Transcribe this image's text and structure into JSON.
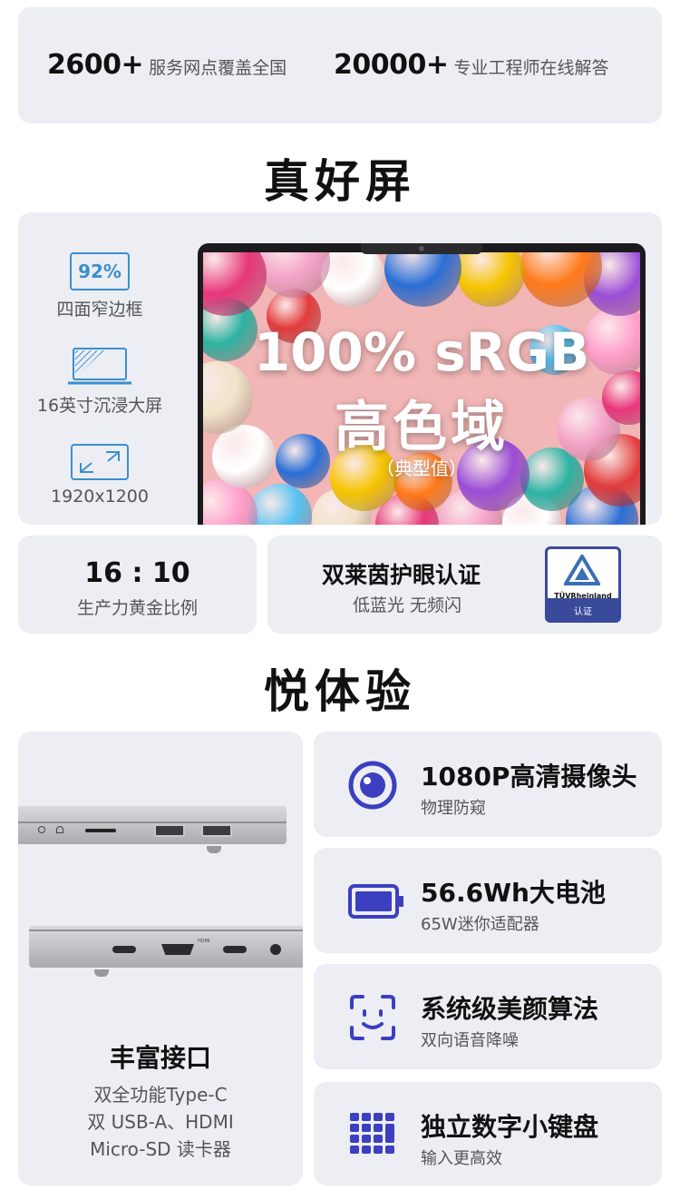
{
  "stats": [
    {
      "num": "2600+",
      "text": "服务网点覆盖全国"
    },
    {
      "num": "20000+",
      "text": "专业工程师在线解答"
    }
  ],
  "section1_title": "真好屏",
  "screen_features": [
    {
      "badge": "92%",
      "label": "四面窄边框",
      "icon": "screen-bezel-icon"
    },
    {
      "label": "16英寸沉浸大屏",
      "icon": "large-screen-icon"
    },
    {
      "label": "1920x1200",
      "icon": "resolution-expand-icon"
    }
  ],
  "screen_overlay": {
    "line1": "100% sRGB",
    "line2": "高色域",
    "note": "（典型值）"
  },
  "ratio_card": {
    "title": "16 : 10",
    "sub": "生产力黄金比例"
  },
  "eye_card": {
    "title": "双莱茵护眼认证",
    "sub": "低蓝光 无频闪",
    "badge_brand": "TÜVRheinland",
    "badge_text": "认证"
  },
  "section2_title": "悦体验",
  "ports_card": {
    "title": "丰富接口",
    "lines": [
      "双全功能Type-C",
      "双 USB-A、HDMI",
      "Micro-SD 读卡器"
    ],
    "port_label_hdmi": "HDMI"
  },
  "experience": [
    {
      "title": "1080P高清摄像头",
      "sub": "物理防窥",
      "icon": "webcam-icon"
    },
    {
      "title": "56.6Wh大电池",
      "sub": "65W迷你适配器",
      "icon": "battery-icon"
    },
    {
      "title": "系统级美颜算法",
      "sub": "双向语音降噪",
      "icon": "face-scan-icon"
    },
    {
      "title": "独立数字小键盘",
      "sub": "输入更高效",
      "icon": "numpad-icon"
    }
  ],
  "colors": {
    "accent": "#3b3fc0",
    "card_bg": "#eceef3"
  }
}
